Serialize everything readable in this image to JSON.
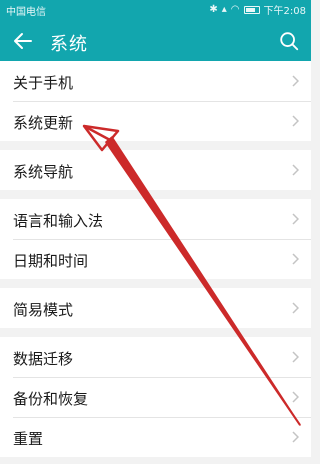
{
  "status_bar": {
    "carrier": "中国电信",
    "status_icons": [
      "bluetooth-icon",
      "signal-icon",
      "wifi-icon"
    ],
    "battery_percent": 80,
    "time": "下午2:08"
  },
  "app_bar": {
    "title": "系统",
    "back_icon": "back-arrow-icon",
    "search_icon": "search-icon",
    "background_color": "#12a6ae"
  },
  "settings": {
    "groups": [
      {
        "items": [
          {
            "label": "关于手机"
          },
          {
            "label": "系统更新"
          }
        ]
      },
      {
        "items": [
          {
            "label": "系统导航"
          }
        ]
      },
      {
        "items": [
          {
            "label": "语言和输入法"
          },
          {
            "label": "日期和时间"
          }
        ]
      },
      {
        "items": [
          {
            "label": "简易模式"
          }
        ]
      },
      {
        "items": [
          {
            "label": "数据迁移"
          },
          {
            "label": "备份和恢复"
          },
          {
            "label": "重置"
          }
        ]
      }
    ]
  },
  "annotation": {
    "type": "arrow",
    "color": "#cc2a2a",
    "points_to": "系统更新"
  }
}
